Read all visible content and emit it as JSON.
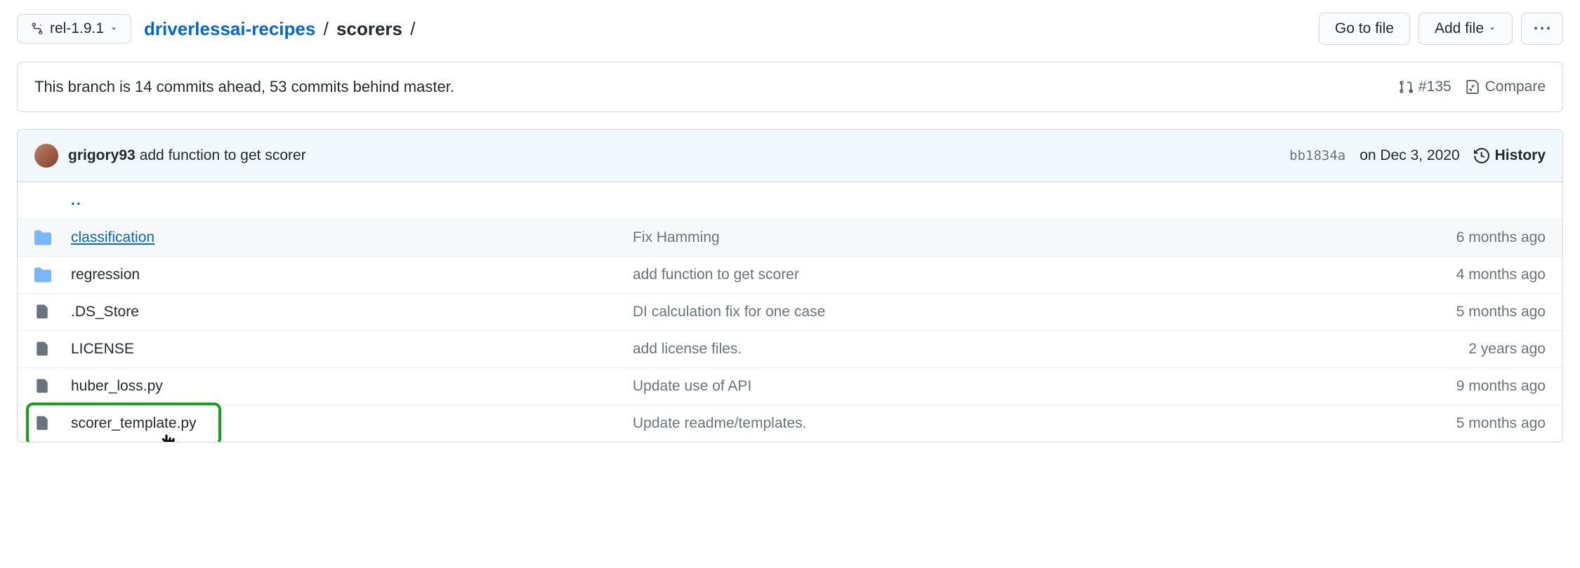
{
  "branch": "rel-1.9.1",
  "breadcrumb": {
    "repo": "driverlessai-recipes",
    "folder": "scorers",
    "trailing": "/"
  },
  "actions": {
    "go_to_file": "Go to file",
    "add_file": "Add file"
  },
  "branch_status": "This branch is 14 commits ahead, 53 commits behind master.",
  "pr_link": "#135",
  "compare_label": "Compare",
  "latest_commit": {
    "author": "grigory93",
    "message": "add function to get scorer",
    "hash": "bb1834a",
    "date": "on Dec 3, 2020"
  },
  "history_label": "History",
  "parent_dir": "..",
  "rows": [
    {
      "type": "folder",
      "name": "classification",
      "commit": "Fix Hamming",
      "age": "6 months ago",
      "hovered": true
    },
    {
      "type": "folder",
      "name": "regression",
      "commit": "add function to get scorer",
      "age": "4 months ago"
    },
    {
      "type": "file",
      "name": ".DS_Store",
      "commit": "DI calculation fix for one case",
      "age": "5 months ago"
    },
    {
      "type": "file",
      "name": "LICENSE",
      "commit": "add license files.",
      "age": "2 years ago"
    },
    {
      "type": "file",
      "name": "huber_loss.py",
      "commit": "Update use of API",
      "age": "9 months ago"
    },
    {
      "type": "file",
      "name": "scorer_template.py",
      "commit": "Update readme/templates.",
      "age": "5 months ago"
    }
  ]
}
